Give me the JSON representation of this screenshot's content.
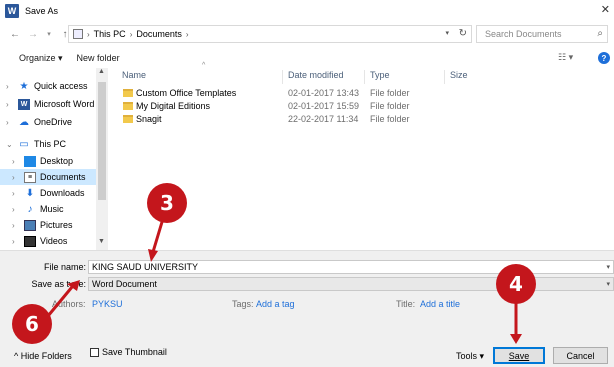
{
  "window": {
    "title": "Save As",
    "app_icon_letter": "W"
  },
  "address": {
    "crumbs": [
      "This PC",
      "Documents"
    ],
    "search_placeholder": "Search Documents"
  },
  "toolbar": {
    "organize": "Organize ▾",
    "new_folder": "New folder"
  },
  "nav": {
    "items": [
      {
        "label": "Quick access",
        "icon": "star-icon"
      },
      {
        "label": "Microsoft Word",
        "icon": "word-icon"
      },
      {
        "label": "OneDrive",
        "icon": "cloud-icon"
      },
      {
        "label": "This PC",
        "icon": "computer-icon"
      },
      {
        "label": "Desktop",
        "icon": "desktop-icon"
      },
      {
        "label": "Documents",
        "icon": "documents-icon"
      },
      {
        "label": "Downloads",
        "icon": "download-icon"
      },
      {
        "label": "Music",
        "icon": "music-icon"
      },
      {
        "label": "Pictures",
        "icon": "pictures-icon"
      },
      {
        "label": "Videos",
        "icon": "videos-icon"
      }
    ]
  },
  "columns": {
    "name": "Name",
    "date": "Date modified",
    "type": "Type",
    "size": "Size"
  },
  "files": [
    {
      "name": "Custom Office Templates",
      "date": "02-01-2017 13:43",
      "type": "File folder"
    },
    {
      "name": "My Digital Editions",
      "date": "02-01-2017 15:59",
      "type": "File folder"
    },
    {
      "name": "Snagit",
      "date": "22-02-2017 11:34",
      "type": "File folder"
    }
  ],
  "form": {
    "file_name_label": "File name:",
    "file_name_value": "KING SAUD UNIVERSITY",
    "save_type_label": "Save as type:",
    "save_type_value": "Word Document",
    "authors_label": "Authors:",
    "authors_value": "PYKSU",
    "tags_label": "Tags:",
    "tags_value": "Add a tag",
    "title_label": "Title:",
    "title_value": "Add a title",
    "thumbnail_label": "Save Thumbnail"
  },
  "footer": {
    "hide_folders": "Hide Folders",
    "tools": "Tools",
    "save": "Save",
    "cancel": "Cancel"
  },
  "callouts": {
    "c3": "3",
    "c4": "4",
    "c6": "6",
    "color": "#c4161c"
  }
}
